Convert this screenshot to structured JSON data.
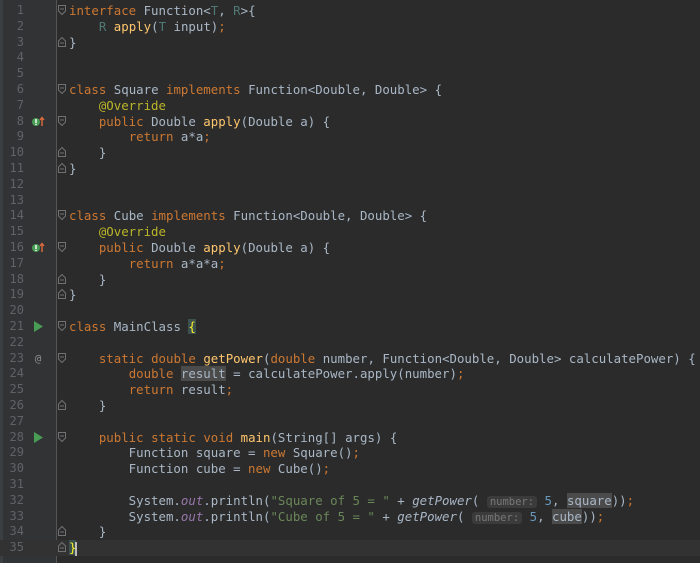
{
  "editor": {
    "colors": {
      "background": "#2b2b2b",
      "gutter": "#313335",
      "keyword": "#cc7832",
      "function": "#ffc66d",
      "string": "#6a8759",
      "number": "#6897bb",
      "annotation": "#bbb529",
      "text": "#a9b7c6"
    },
    "lines": [
      {
        "n": "1",
        "marker": "",
        "fold": "open",
        "tokens": [
          [
            "k",
            "interface"
          ],
          [
            "t",
            " Function<"
          ],
          [
            "tp",
            "T"
          ],
          [
            "t",
            ", "
          ],
          [
            "tp",
            "R"
          ],
          [
            "t",
            ">{"
          ]
        ]
      },
      {
        "n": "2",
        "marker": "",
        "fold": "",
        "tokens": [
          [
            "t",
            "    "
          ],
          [
            "tp",
            "R"
          ],
          [
            "t",
            " "
          ],
          [
            "fn",
            "apply"
          ],
          [
            "t",
            "("
          ],
          [
            "tp",
            "T"
          ],
          [
            "t",
            " input)"
          ],
          [
            "k",
            ";"
          ]
        ]
      },
      {
        "n": "3",
        "marker": "",
        "fold": "close",
        "tokens": [
          [
            "t",
            "}"
          ]
        ]
      },
      {
        "n": "4",
        "marker": "",
        "fold": "",
        "tokens": []
      },
      {
        "n": "5",
        "marker": "",
        "fold": "",
        "tokens": []
      },
      {
        "n": "6",
        "marker": "",
        "fold": "open",
        "tokens": [
          [
            "k",
            "class"
          ],
          [
            "t",
            " Square "
          ],
          [
            "k",
            "implements"
          ],
          [
            "t",
            " Function<Double, Double> {"
          ]
        ]
      },
      {
        "n": "7",
        "marker": "",
        "fold": "",
        "tokens": [
          [
            "t",
            "    "
          ],
          [
            "ann",
            "@Override"
          ]
        ]
      },
      {
        "n": "8",
        "marker": "impl-icon",
        "fold": "open",
        "tokens": [
          [
            "t",
            "    "
          ],
          [
            "k",
            "public"
          ],
          [
            "t",
            " Double "
          ],
          [
            "fn",
            "apply"
          ],
          [
            "t",
            "(Double a) {"
          ]
        ]
      },
      {
        "n": "9",
        "marker": "",
        "fold": "",
        "tokens": [
          [
            "t",
            "        "
          ],
          [
            "k",
            "return"
          ],
          [
            "t",
            " a*a"
          ],
          [
            "k",
            ";"
          ]
        ]
      },
      {
        "n": "10",
        "marker": "",
        "fold": "close",
        "tokens": [
          [
            "t",
            "    }"
          ]
        ]
      },
      {
        "n": "11",
        "marker": "",
        "fold": "close",
        "tokens": [
          [
            "t",
            "}"
          ]
        ]
      },
      {
        "n": "12",
        "marker": "",
        "fold": "",
        "tokens": []
      },
      {
        "n": "13",
        "marker": "",
        "fold": "",
        "tokens": []
      },
      {
        "n": "14",
        "marker": "",
        "fold": "open",
        "tokens": [
          [
            "k",
            "class"
          ],
          [
            "t",
            " Cube "
          ],
          [
            "k",
            "implements"
          ],
          [
            "t",
            " Function<Double, Double> {"
          ]
        ]
      },
      {
        "n": "15",
        "marker": "",
        "fold": "",
        "tokens": [
          [
            "t",
            "    "
          ],
          [
            "ann",
            "@Override"
          ]
        ]
      },
      {
        "n": "16",
        "marker": "impl-icon",
        "fold": "open",
        "tokens": [
          [
            "t",
            "    "
          ],
          [
            "k",
            "public"
          ],
          [
            "t",
            " Double "
          ],
          [
            "fn",
            "apply"
          ],
          [
            "t",
            "(Double a) {"
          ]
        ]
      },
      {
        "n": "17",
        "marker": "",
        "fold": "",
        "tokens": [
          [
            "t",
            "        "
          ],
          [
            "k",
            "return"
          ],
          [
            "t",
            " a*a*a"
          ],
          [
            "k",
            ";"
          ]
        ]
      },
      {
        "n": "18",
        "marker": "",
        "fold": "close",
        "tokens": [
          [
            "t",
            "    }"
          ]
        ]
      },
      {
        "n": "19",
        "marker": "",
        "fold": "close",
        "tokens": [
          [
            "t",
            "}"
          ]
        ]
      },
      {
        "n": "20",
        "marker": "",
        "fold": "",
        "tokens": []
      },
      {
        "n": "21",
        "marker": "run-icon",
        "fold": "open",
        "tokens": [
          [
            "k",
            "class"
          ],
          [
            "t",
            " MainClass "
          ],
          [
            "bh",
            "{"
          ]
        ]
      },
      {
        "n": "22",
        "marker": "",
        "fold": "",
        "tokens": []
      },
      {
        "n": "23",
        "marker": "at-icon",
        "fold": "open",
        "tokens": [
          [
            "t",
            "    "
          ],
          [
            "k",
            "static"
          ],
          [
            "t",
            " "
          ],
          [
            "k",
            "double"
          ],
          [
            "t",
            " "
          ],
          [
            "fn",
            "getPower"
          ],
          [
            "t",
            "("
          ],
          [
            "k",
            "double"
          ],
          [
            "t",
            " number, Function<Double, Double> calculatePower) {"
          ]
        ]
      },
      {
        "n": "24",
        "marker": "",
        "fold": "",
        "tokens": [
          [
            "t",
            "        "
          ],
          [
            "k",
            "double"
          ],
          [
            "t",
            " "
          ],
          [
            "hl",
            "result"
          ],
          [
            "t",
            " = calculatePower.apply(number)"
          ],
          [
            "k",
            ";"
          ]
        ]
      },
      {
        "n": "25",
        "marker": "",
        "fold": "",
        "tokens": [
          [
            "t",
            "        "
          ],
          [
            "k",
            "return"
          ],
          [
            "t",
            " result"
          ],
          [
            "k",
            ";"
          ]
        ]
      },
      {
        "n": "26",
        "marker": "",
        "fold": "close",
        "tokens": [
          [
            "t",
            "    }"
          ]
        ]
      },
      {
        "n": "27",
        "marker": "",
        "fold": "",
        "tokens": []
      },
      {
        "n": "28",
        "marker": "run-icon",
        "fold": "open",
        "tokens": [
          [
            "t",
            "    "
          ],
          [
            "k",
            "public"
          ],
          [
            "t",
            " "
          ],
          [
            "k",
            "static"
          ],
          [
            "t",
            " "
          ],
          [
            "k",
            "void"
          ],
          [
            "t",
            " "
          ],
          [
            "fn",
            "main"
          ],
          [
            "t",
            "(String[] args) {"
          ]
        ]
      },
      {
        "n": "29",
        "marker": "",
        "fold": "",
        "tokens": [
          [
            "t",
            "        Function square = "
          ],
          [
            "k",
            "new"
          ],
          [
            "t",
            " Square()"
          ],
          [
            "k",
            ";"
          ]
        ]
      },
      {
        "n": "30",
        "marker": "",
        "fold": "",
        "tokens": [
          [
            "t",
            "        Function cube = "
          ],
          [
            "k",
            "new"
          ],
          [
            "t",
            " Cube()"
          ],
          [
            "k",
            ";"
          ]
        ]
      },
      {
        "n": "31",
        "marker": "",
        "fold": "",
        "tokens": []
      },
      {
        "n": "32",
        "marker": "",
        "fold": "",
        "tokens": [
          [
            "t",
            "        System."
          ],
          [
            "ital",
            "out"
          ],
          [
            "t",
            "."
          ],
          [
            "t",
            "println("
          ],
          [
            "str",
            "\"Square of 5 = \""
          ],
          [
            "t",
            " + "
          ],
          [
            "itf",
            "getPower"
          ],
          [
            "t",
            "( "
          ],
          [
            "hint",
            "number:"
          ],
          [
            "t",
            " "
          ],
          [
            "num",
            "5"
          ],
          [
            "t",
            ", "
          ],
          [
            "hl",
            "square"
          ],
          [
            "t",
            "))"
          ],
          [
            "k",
            ";"
          ]
        ]
      },
      {
        "n": "33",
        "marker": "",
        "fold": "",
        "tokens": [
          [
            "t",
            "        System."
          ],
          [
            "ital",
            "out"
          ],
          [
            "t",
            "."
          ],
          [
            "t",
            "println("
          ],
          [
            "str",
            "\"Cube of 5 = \""
          ],
          [
            "t",
            " + "
          ],
          [
            "itf",
            "getPower"
          ],
          [
            "t",
            "( "
          ],
          [
            "hint",
            "number:"
          ],
          [
            "t",
            " "
          ],
          [
            "num",
            "5"
          ],
          [
            "t",
            ", "
          ],
          [
            "hl",
            "cube"
          ],
          [
            "t",
            "))"
          ],
          [
            "k",
            ";"
          ]
        ]
      },
      {
        "n": "34",
        "marker": "",
        "fold": "close",
        "tokens": [
          [
            "t",
            "    }"
          ]
        ]
      },
      {
        "n": "35",
        "marker": "",
        "fold": "close",
        "current": true,
        "tokens": [
          [
            "bh",
            "}"
          ]
        ]
      }
    ]
  }
}
